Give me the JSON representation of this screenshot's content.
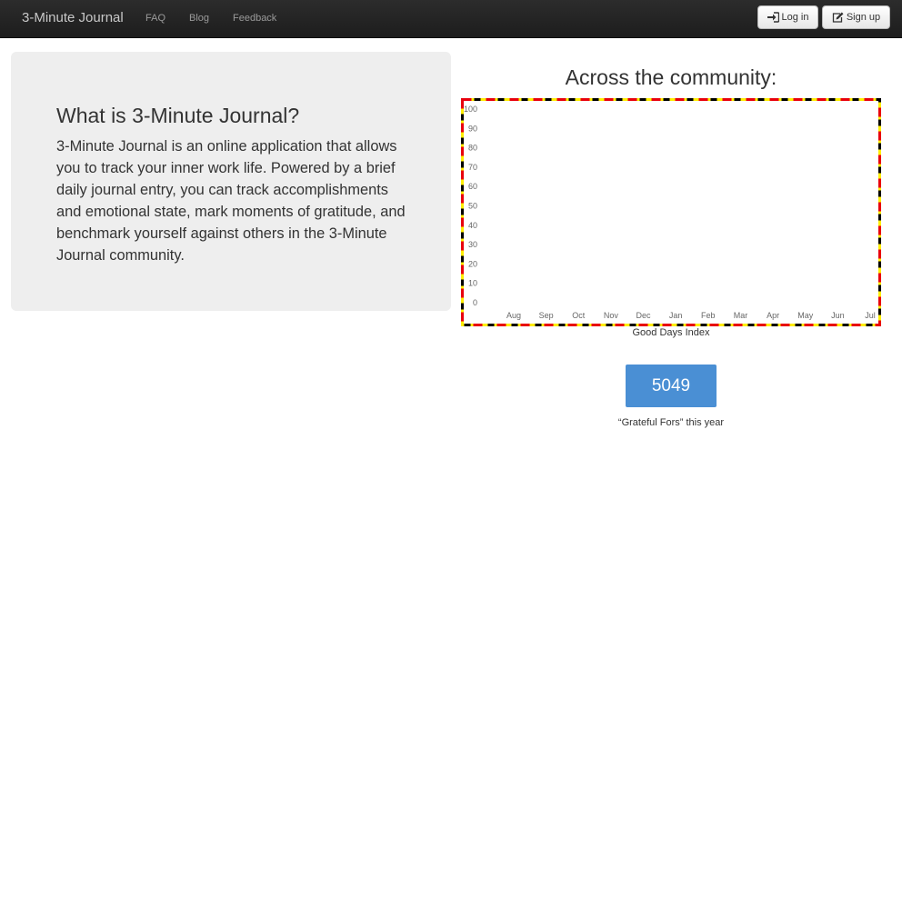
{
  "navbar": {
    "brand": "3-Minute Journal",
    "links": [
      "FAQ",
      "Blog",
      "Feedback"
    ],
    "login_label": "Log in",
    "signup_label": "Sign up",
    "login_icon": "sign-in-icon",
    "signup_icon": "edit-icon"
  },
  "hero": {
    "title": "What is 3-Minute Journal?",
    "body": "3-Minute Journal is an online application that allows you to track your inner work life. Powered by a brief daily journal entry, you can track accomplishments and emotional state, mark moments of gratitude, and benchmark yourself against others in the 3-Minute Journal community."
  },
  "community": {
    "title": "Across the community:",
    "chart_caption": "Good Days Index",
    "grateful_count": "5049",
    "grateful_caption": "“Grateful Fors” this year"
  },
  "colors": {
    "navbar_bg": "#222222",
    "hero_bg": "#eeeeee",
    "count_bg": "#4a8fd4",
    "border_black": "#000000",
    "border_red": "#e8000d",
    "border_yellow": "#ffee00"
  },
  "chart_data": {
    "type": "line",
    "title": "",
    "xlabel": "",
    "ylabel": "",
    "categories": [
      "Aug",
      "Sep",
      "Oct",
      "Nov",
      "Dec",
      "Jan",
      "Feb",
      "Mar",
      "Apr",
      "May",
      "Jun",
      "Jul"
    ],
    "y_ticks": [
      0,
      10,
      20,
      30,
      40,
      50,
      60,
      70,
      80,
      90,
      100
    ],
    "ylim": [
      0,
      100
    ],
    "series": [],
    "grid": false
  }
}
